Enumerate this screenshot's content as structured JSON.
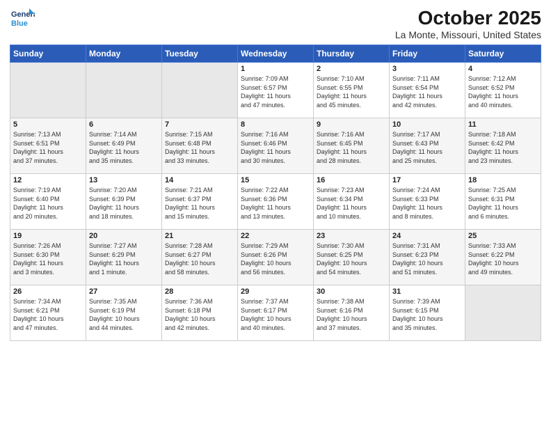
{
  "logo": {
    "line1": "General",
    "line2": "Blue"
  },
  "title": "October 2025",
  "subtitle": "La Monte, Missouri, United States",
  "headers": [
    "Sunday",
    "Monday",
    "Tuesday",
    "Wednesday",
    "Thursday",
    "Friday",
    "Saturday"
  ],
  "weeks": [
    [
      {
        "day": "",
        "info": ""
      },
      {
        "day": "",
        "info": ""
      },
      {
        "day": "",
        "info": ""
      },
      {
        "day": "1",
        "info": "Sunrise: 7:09 AM\nSunset: 6:57 PM\nDaylight: 11 hours\nand 47 minutes."
      },
      {
        "day": "2",
        "info": "Sunrise: 7:10 AM\nSunset: 6:55 PM\nDaylight: 11 hours\nand 45 minutes."
      },
      {
        "day": "3",
        "info": "Sunrise: 7:11 AM\nSunset: 6:54 PM\nDaylight: 11 hours\nand 42 minutes."
      },
      {
        "day": "4",
        "info": "Sunrise: 7:12 AM\nSunset: 6:52 PM\nDaylight: 11 hours\nand 40 minutes."
      }
    ],
    [
      {
        "day": "5",
        "info": "Sunrise: 7:13 AM\nSunset: 6:51 PM\nDaylight: 11 hours\nand 37 minutes."
      },
      {
        "day": "6",
        "info": "Sunrise: 7:14 AM\nSunset: 6:49 PM\nDaylight: 11 hours\nand 35 minutes."
      },
      {
        "day": "7",
        "info": "Sunrise: 7:15 AM\nSunset: 6:48 PM\nDaylight: 11 hours\nand 33 minutes."
      },
      {
        "day": "8",
        "info": "Sunrise: 7:16 AM\nSunset: 6:46 PM\nDaylight: 11 hours\nand 30 minutes."
      },
      {
        "day": "9",
        "info": "Sunrise: 7:16 AM\nSunset: 6:45 PM\nDaylight: 11 hours\nand 28 minutes."
      },
      {
        "day": "10",
        "info": "Sunrise: 7:17 AM\nSunset: 6:43 PM\nDaylight: 11 hours\nand 25 minutes."
      },
      {
        "day": "11",
        "info": "Sunrise: 7:18 AM\nSunset: 6:42 PM\nDaylight: 11 hours\nand 23 minutes."
      }
    ],
    [
      {
        "day": "12",
        "info": "Sunrise: 7:19 AM\nSunset: 6:40 PM\nDaylight: 11 hours\nand 20 minutes."
      },
      {
        "day": "13",
        "info": "Sunrise: 7:20 AM\nSunset: 6:39 PM\nDaylight: 11 hours\nand 18 minutes."
      },
      {
        "day": "14",
        "info": "Sunrise: 7:21 AM\nSunset: 6:37 PM\nDaylight: 11 hours\nand 15 minutes."
      },
      {
        "day": "15",
        "info": "Sunrise: 7:22 AM\nSunset: 6:36 PM\nDaylight: 11 hours\nand 13 minutes."
      },
      {
        "day": "16",
        "info": "Sunrise: 7:23 AM\nSunset: 6:34 PM\nDaylight: 11 hours\nand 10 minutes."
      },
      {
        "day": "17",
        "info": "Sunrise: 7:24 AM\nSunset: 6:33 PM\nDaylight: 11 hours\nand 8 minutes."
      },
      {
        "day": "18",
        "info": "Sunrise: 7:25 AM\nSunset: 6:31 PM\nDaylight: 11 hours\nand 6 minutes."
      }
    ],
    [
      {
        "day": "19",
        "info": "Sunrise: 7:26 AM\nSunset: 6:30 PM\nDaylight: 11 hours\nand 3 minutes."
      },
      {
        "day": "20",
        "info": "Sunrise: 7:27 AM\nSunset: 6:29 PM\nDaylight: 11 hours\nand 1 minute."
      },
      {
        "day": "21",
        "info": "Sunrise: 7:28 AM\nSunset: 6:27 PM\nDaylight: 10 hours\nand 58 minutes."
      },
      {
        "day": "22",
        "info": "Sunrise: 7:29 AM\nSunset: 6:26 PM\nDaylight: 10 hours\nand 56 minutes."
      },
      {
        "day": "23",
        "info": "Sunrise: 7:30 AM\nSunset: 6:25 PM\nDaylight: 10 hours\nand 54 minutes."
      },
      {
        "day": "24",
        "info": "Sunrise: 7:31 AM\nSunset: 6:23 PM\nDaylight: 10 hours\nand 51 minutes."
      },
      {
        "day": "25",
        "info": "Sunrise: 7:33 AM\nSunset: 6:22 PM\nDaylight: 10 hours\nand 49 minutes."
      }
    ],
    [
      {
        "day": "26",
        "info": "Sunrise: 7:34 AM\nSunset: 6:21 PM\nDaylight: 10 hours\nand 47 minutes."
      },
      {
        "day": "27",
        "info": "Sunrise: 7:35 AM\nSunset: 6:19 PM\nDaylight: 10 hours\nand 44 minutes."
      },
      {
        "day": "28",
        "info": "Sunrise: 7:36 AM\nSunset: 6:18 PM\nDaylight: 10 hours\nand 42 minutes."
      },
      {
        "day": "29",
        "info": "Sunrise: 7:37 AM\nSunset: 6:17 PM\nDaylight: 10 hours\nand 40 minutes."
      },
      {
        "day": "30",
        "info": "Sunrise: 7:38 AM\nSunset: 6:16 PM\nDaylight: 10 hours\nand 37 minutes."
      },
      {
        "day": "31",
        "info": "Sunrise: 7:39 AM\nSunset: 6:15 PM\nDaylight: 10 hours\nand 35 minutes."
      },
      {
        "day": "",
        "info": ""
      }
    ]
  ]
}
